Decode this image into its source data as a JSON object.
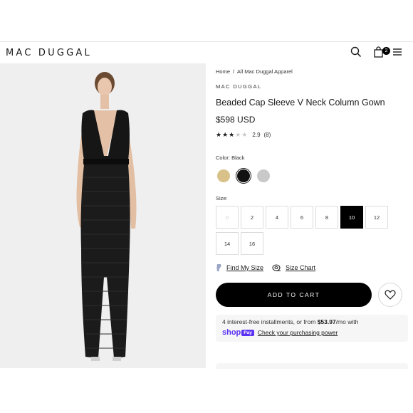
{
  "header": {
    "logo": "MAC DUGGAL",
    "cart_count": "2",
    "icons": [
      "search-icon",
      "bag-icon",
      "menu-icon"
    ]
  },
  "breadcrumb": {
    "home": "Home",
    "sep": "/",
    "current": "All Mac Duggal Apparel"
  },
  "product": {
    "brand": "MAC DUGGAL",
    "title": "Beaded Cap Sleeve V Neck Column Gown",
    "price": "$598 USD",
    "rating_value": "2.9",
    "rating_count": "(8)",
    "stars_filled": 3,
    "stars_total": 5
  },
  "color": {
    "label": "Color: Black",
    "swatches": [
      {
        "name": "gold",
        "hex": "#d9c28a"
      },
      {
        "name": "black",
        "hex": "#111111",
        "selected": true
      },
      {
        "name": "silver",
        "hex": "#c9c9c9"
      }
    ]
  },
  "size": {
    "label": "Size:",
    "options": [
      "0",
      "2",
      "4",
      "6",
      "8",
      "10",
      "12",
      "14",
      "16"
    ],
    "disabled": "0",
    "selected": "10"
  },
  "links": {
    "find_size": "Find My Size",
    "size_chart": "Size Chart"
  },
  "cta": {
    "add_to_cart": "ADD TO CART"
  },
  "shoppay": {
    "text_before": "4 interest-free installments, or from ",
    "amount": "$53.97",
    "text_after": "/mo with",
    "shop": "shop",
    "pay": "Pay",
    "check": "Check your purchasing power"
  },
  "colors": {
    "accent": "#000000",
    "shoppay": "#5a31f4",
    "photo_bg": "#efefef"
  }
}
